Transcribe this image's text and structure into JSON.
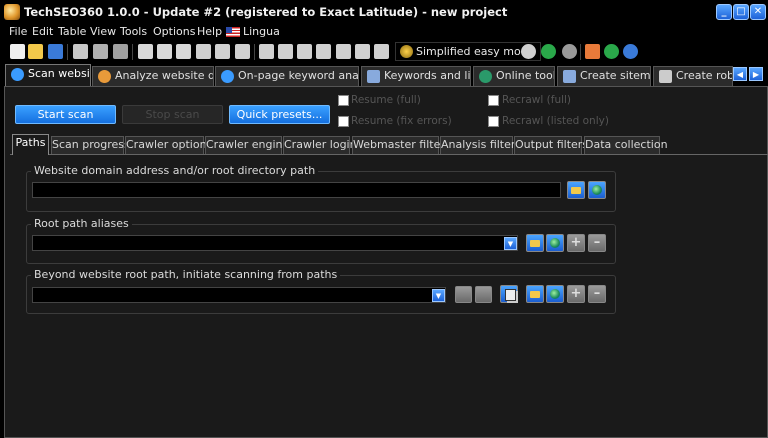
{
  "window": {
    "title": "TechSEO360 1.0.0 - Update #2 (registered to Exact Latitude) - new project",
    "controls": {
      "minimize": "_",
      "maximize": "□",
      "close": "✕"
    }
  },
  "menu": {
    "items": [
      "File",
      "Edit",
      "Table",
      "View",
      "Tools",
      "Options",
      "Help",
      "Lingua"
    ]
  },
  "toolbar": {
    "simplified_label": "Simplified easy mode",
    "icons": [
      "new-file-icon",
      "open-folder-icon",
      "save-icon",
      "tree-icon",
      "wizard-icon",
      "tools-icon",
      "cut-icon",
      "copy-icon",
      "paste-icon",
      "undo-icon",
      "search-icon",
      "find-icon",
      "filter-icon",
      "column-icon",
      "sort-icon",
      "export-icon",
      "import-icon",
      "collapse-icon",
      "expand-icon",
      "simplified-mode-icon",
      "record-icon",
      "go-icon",
      "refresh-icon",
      "home-icon",
      "share-icon",
      "help-icon"
    ]
  },
  "main_tabs": [
    {
      "label": "Scan website",
      "icon": "globe-search-icon",
      "color": "#3a9bff"
    },
    {
      "label": "Analyze website data",
      "icon": "chart-globe-icon",
      "color": "#e89a3a"
    },
    {
      "label": "On-page keyword analysis",
      "icon": "keyword-search-icon",
      "color": "#3a9bff"
    },
    {
      "label": "Keywords and lists",
      "icon": "list-icon",
      "color": "#88aadd"
    },
    {
      "label": "Online tools",
      "icon": "online-globe-icon",
      "color": "#2a9a6a"
    },
    {
      "label": "Create sitemap",
      "icon": "sitemap-icon",
      "color": "#88aadd"
    },
    {
      "label": "Create robots",
      "icon": "robots-filter-icon",
      "color": "#cccccc"
    }
  ],
  "actions": {
    "start_scan": "Start scan",
    "stop_scan": "Stop scan",
    "quick_presets": "Quick presets..."
  },
  "checkboxes": {
    "resume_full": "Resume (full)",
    "resume_fix_errors": "Resume (fix errors)",
    "recrawl_full": "Recrawl (full)",
    "recrawl_listed_only": "Recrawl (listed only)"
  },
  "sub_tabs": [
    "Paths",
    "Scan progress",
    "Crawler options",
    "Crawler engine",
    "Crawler login",
    "Webmaster filters",
    "Analysis filters",
    "Output filters",
    "Data collection"
  ],
  "groups": {
    "domain": {
      "label": "Website domain address and/or root directory path",
      "value": ""
    },
    "aliases": {
      "label": "Root path aliases",
      "value": ""
    },
    "beyond": {
      "label": "Beyond website root path, initiate scanning from paths",
      "value": ""
    }
  },
  "colors": {
    "accent": "#1d7ae8",
    "panel": "#1a1a1a",
    "background": "#000000"
  }
}
